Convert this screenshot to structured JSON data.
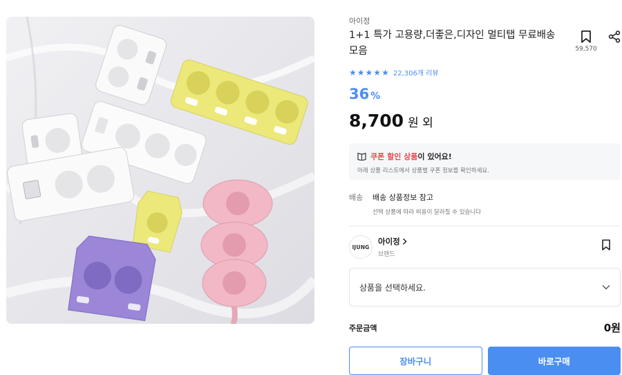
{
  "product": {
    "brand_top": "아이정",
    "title": "1+1 특가 고용량,더좋은,디자인 멀티탭 무료배송 모음",
    "wish_count": "59,570",
    "review_count": "22,306개 리뷰",
    "rating_stars": 5,
    "discount": "36",
    "discount_unit": "%",
    "price": "8,700",
    "price_unit": "원 외"
  },
  "coupon": {
    "highlight": "쿠폰 할인 상품",
    "rest": "이 있어요!",
    "sub": "아래 상품 리스트에서 상품별 쿠폰 정보를 확인하세요."
  },
  "shipping": {
    "label": "배송",
    "main": "배송 상품정보 참고",
    "sub": "선택 상품에 따라 비용이 달라질 수 있습니다"
  },
  "brand": {
    "logo_text": "IJUNG",
    "name": "아이정",
    "sub": "브랜드"
  },
  "option_select": {
    "placeholder": "상품을 선택하세요."
  },
  "order": {
    "label": "주문금액",
    "value": "0원"
  },
  "buttons": {
    "cart": "장바구니",
    "buy": "바로구매"
  },
  "colors": {
    "accent": "#4b8ef1",
    "coupon_red": "#e8474a"
  },
  "icons": [
    "bookmark-icon",
    "share-icon",
    "star-icon",
    "coupon-icon",
    "chevron-right-icon",
    "chevron-down-icon"
  ]
}
